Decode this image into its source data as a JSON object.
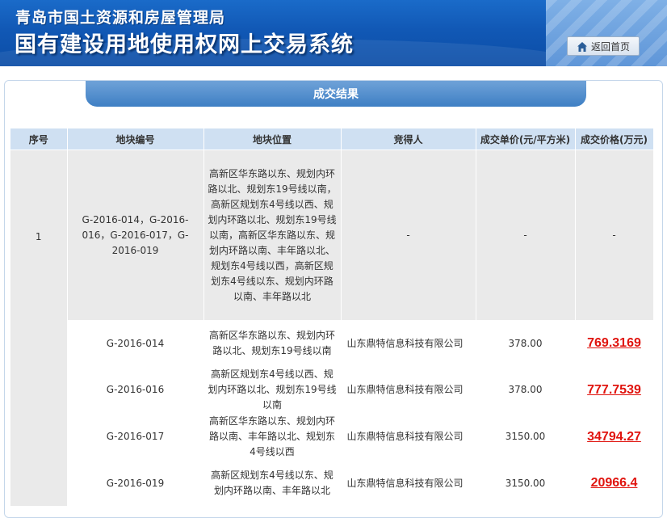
{
  "header": {
    "bureau_name": "青岛市国土资源和房屋管理局",
    "system_name": "国有建设用地使用权网上交易系统",
    "home_button_label": "返回首页",
    "home_icon": "house-icon"
  },
  "panel": {
    "title": "成交结果"
  },
  "table": {
    "columns": [
      "序号",
      "地块编号",
      "地块位置",
      "竞得人",
      "成交单价(元/平方米)",
      "成交价格(万元)"
    ],
    "main_row": {
      "seq": "1",
      "parcel_ids": "G-2016-014，G-2016-016，G-2016-017，G-2016-019",
      "location": "高新区华东路以东、规划内环路以北、规划东19号线以南，高新区规划东4号线以西、规划内环路以北、规划东19号线以南，高新区华东路以东、规划内环路以南、丰年路以北、规划东4号线以西，高新区规划东4号线以东、规划内环路以南、丰年路以北",
      "winner": "-",
      "unit_price": "-",
      "total_price": "-"
    },
    "sub_rows": [
      {
        "parcel_id": "G-2016-014",
        "location": "高新区华东路以东、规划内环路以北、规划东19号线以南",
        "winner": "山东鼎特信息科技有限公司",
        "unit_price": "378.00",
        "total_price": "769.3169"
      },
      {
        "parcel_id": "G-2016-016",
        "location": "高新区规划东4号线以西、规划内环路以北、规划东19号线以南",
        "winner": "山东鼎特信息科技有限公司",
        "unit_price": "378.00",
        "total_price": "777.7539"
      },
      {
        "parcel_id": "G-2016-017",
        "location": "高新区华东路以东、规划内环路以南、丰年路以北、规划东4号线以西",
        "winner": "山东鼎特信息科技有限公司",
        "unit_price": "3150.00",
        "total_price": "34794.27"
      },
      {
        "parcel_id": "G-2016-019",
        "location": "高新区规划东4号线以东、规划内环路以南、丰年路以北",
        "winner": "山东鼎特信息科技有限公司",
        "unit_price": "3150.00",
        "total_price": "20966.4"
      }
    ]
  },
  "colors": {
    "header_blue": "#1158b5",
    "table_header_bg": "#cfe0f2",
    "main_row_bg": "#eaeaea",
    "price_red": "#e0140e"
  }
}
